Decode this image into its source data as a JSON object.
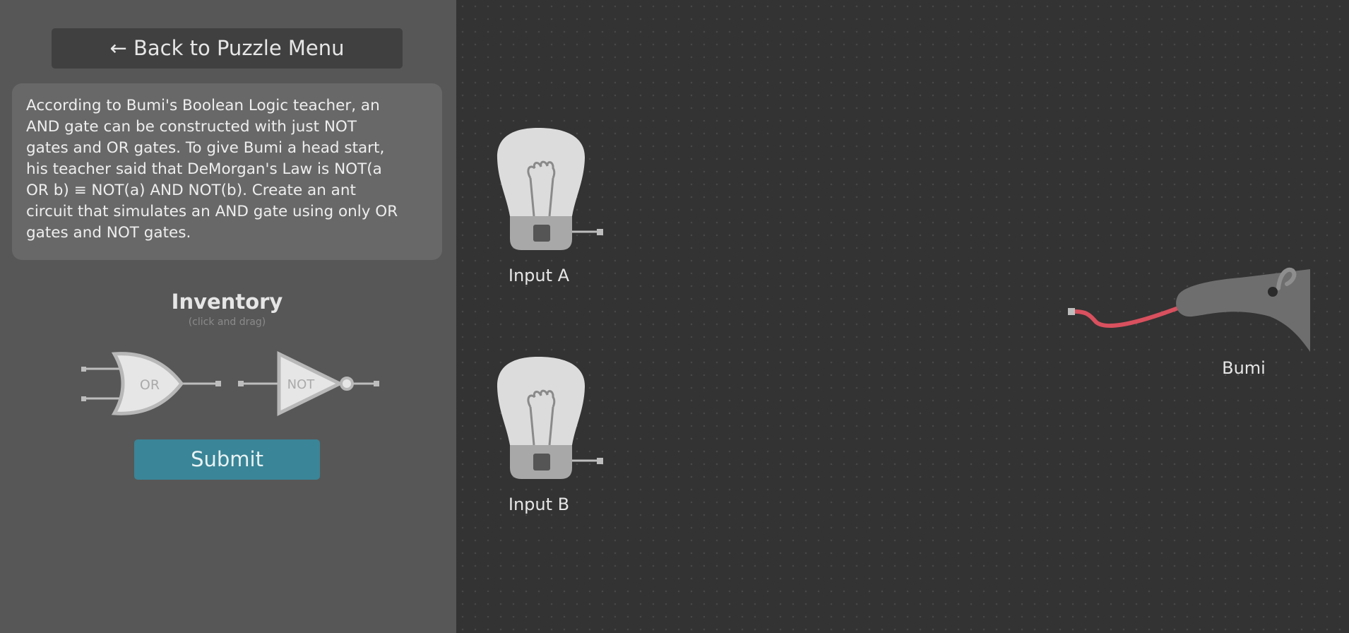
{
  "sidebar": {
    "back_label": "← Back to Puzzle Menu",
    "description": "According to Bumi's Boolean Logic teacher, an\nAND gate can be constructed with just NOT\ngates and OR gates. To give Bumi a head start,\nhis teacher said that DeMorgan's Law is NOT(a\nOR b) ≡ NOT(a) AND NOT(b). Create an ant\ncircuit that simulates an AND gate using only OR\ngates and NOT gates.",
    "inventory_title": "Inventory",
    "inventory_hint": "(click and drag)",
    "gates": [
      {
        "label": "OR",
        "icon": "or-gate-icon"
      },
      {
        "label": "NOT",
        "icon": "not-gate-icon"
      }
    ],
    "submit_label": "Submit"
  },
  "canvas": {
    "inputs": [
      {
        "label": "Input A",
        "icon": "light-bulb-icon"
      },
      {
        "label": "Input B",
        "icon": "light-bulb-icon"
      }
    ],
    "output": {
      "label": "Bumi",
      "icon": "anteater-icon"
    }
  },
  "colors": {
    "sidebar_bg": "#575757",
    "canvas_bg": "#333333",
    "submit_bg": "#3a8597",
    "wire": "#d9505e"
  }
}
